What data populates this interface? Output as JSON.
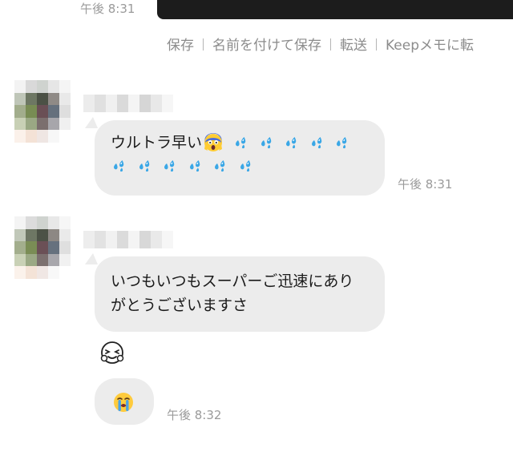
{
  "top_message": {
    "time": "午後 8:31"
  },
  "actions": [
    {
      "name": "save-link",
      "label": "保存"
    },
    {
      "name": "save-as-link",
      "label": "名前を付けて保存"
    },
    {
      "name": "forward-link",
      "label": "転送"
    },
    {
      "name": "keep-memo-link",
      "label": "Keepメモに転"
    }
  ],
  "messages": [
    {
      "text": "ウルトラ早い",
      "reaction_icons": [
        "scream-face-icon",
        "sweat-droplets-icon"
      ],
      "time": "午後 8:31"
    },
    {
      "text_line1": "いつもいつもスーパーご迅速にあり",
      "text_line2": "がとうございますさ",
      "sticker_icon": "squinting-face-outline-icon"
    },
    {
      "emoji_icon": "loudly-crying-face-icon",
      "time": "午後 8:32"
    }
  ],
  "colors": {
    "bubble": "#ececec",
    "time_text": "#9a9a9a",
    "action_text": "#8c8c8c",
    "droplet": "#3aa7e6",
    "scream_face": "#4f6fd6"
  }
}
